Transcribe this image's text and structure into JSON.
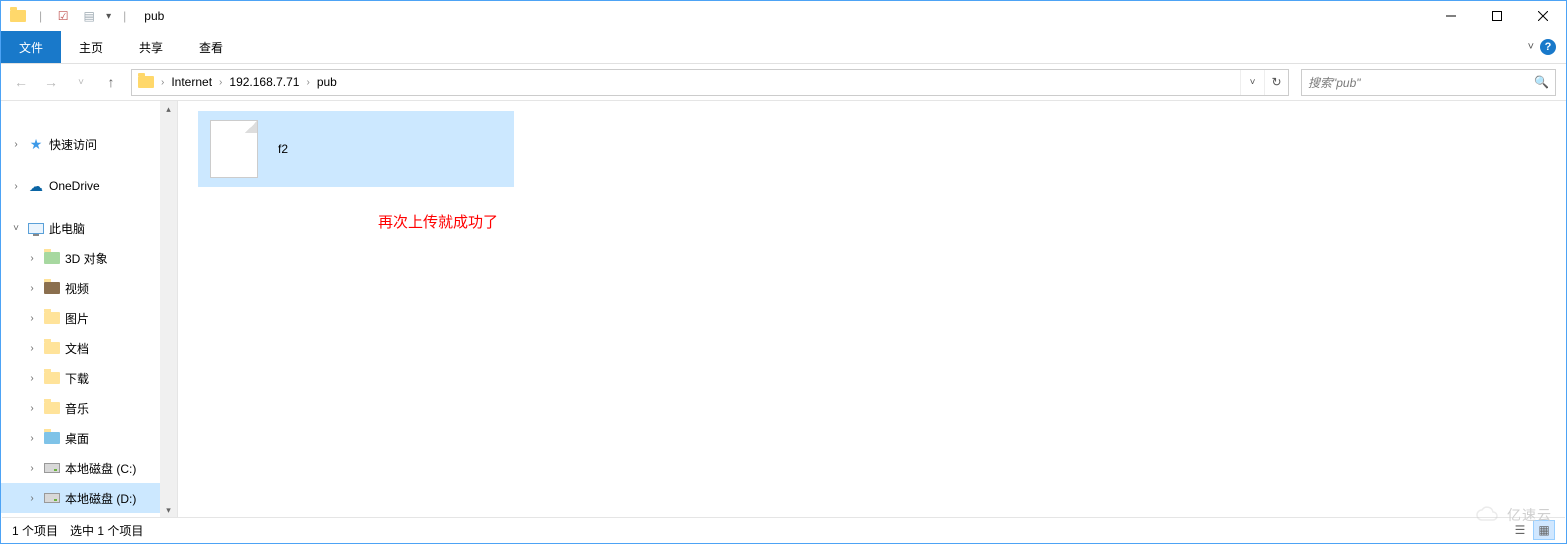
{
  "title": "pub",
  "ribbon": {
    "file": "文件",
    "tabs": [
      "主页",
      "共享",
      "查看"
    ]
  },
  "nav": {
    "crumbs": [
      "Internet",
      "192.168.7.71",
      "pub"
    ]
  },
  "search": {
    "placeholder": "搜索\"pub\""
  },
  "sidebar": {
    "quick_access": "快速访问",
    "onedrive": "OneDrive",
    "this_pc": "此电脑",
    "items": [
      {
        "label": "3D 对象"
      },
      {
        "label": "视频"
      },
      {
        "label": "图片"
      },
      {
        "label": "文档"
      },
      {
        "label": "下载"
      },
      {
        "label": "音乐"
      },
      {
        "label": "桌面"
      },
      {
        "label": "本地磁盘 (C:)"
      },
      {
        "label": "本地磁盘 (D:)"
      }
    ]
  },
  "content": {
    "files": [
      {
        "name": "f2"
      }
    ],
    "annotation": "再次上传就成功了"
  },
  "status": {
    "total": "1 个项目",
    "selected": "选中 1 个项目"
  },
  "watermark": "亿速云"
}
